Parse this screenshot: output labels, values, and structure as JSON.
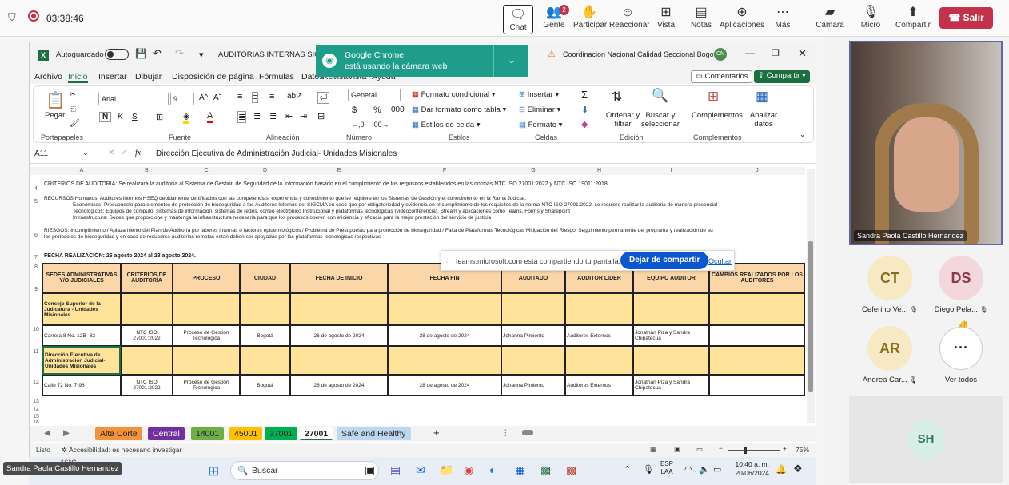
{
  "teams": {
    "time": "03:38:46",
    "chat": "Chat",
    "people": "Gente",
    "people_badge": "2",
    "raise": "Participar",
    "react": "Reaccionar",
    "view": "Vista",
    "notes": "Notas",
    "apps": "Aplicaciones",
    "more": "Más",
    "camera": "Cámara",
    "mic": "Micro",
    "share": "Compartir",
    "leave": "Salir"
  },
  "excel": {
    "autosave": "Autoguardado",
    "doc_title": "AUDITORIAS INTERNAS SIGCMA",
    "account": "Coordinacion Nacional Calidad Seccional Bogotá",
    "account_initials": "CN",
    "tabs": [
      "Archivo",
      "Inicio",
      "Insertar",
      "Dibujar",
      "Disposición de página",
      "Fórmulas",
      "Datos",
      "Revisar",
      "Vista",
      "Ayuda"
    ],
    "comments": "Comentarios",
    "share": "Compartir",
    "ribbon": {
      "paste": "Pegar",
      "font": "Arial",
      "size": "9",
      "numfmt": "General",
      "cond": "Formato condicional",
      "table": "Dar formato como tabla",
      "styles": "Estilos de celda",
      "insert": "Insertar",
      "delete": "Eliminar",
      "format": "Formato",
      "sort": "Ordenar y filtrar",
      "find": "Buscar y seleccionar",
      "addins": "Complementos",
      "analyze": "Analizar datos",
      "groups": [
        "Portapapeles",
        "Fuente",
        "Alineación",
        "Número",
        "Estilos",
        "Celdas",
        "Edición",
        "Complementos"
      ]
    },
    "namebox": "A11",
    "formula": "Dirección Ejecutiva de Administración Judicial- Unidades Misionales",
    "cols": [
      "A",
      "B",
      "C",
      "D",
      "E",
      "F",
      "G",
      "H",
      "I",
      "J"
    ],
    "criterios": "CRITERIOS DE AUDITORIA: Se realizará la auditoría al Sistema de Gestión de Seguridad de la Información basado en el cumplimiento de los requisitos establecidos en las normas NTC ISO 27001:2022 y NTC ISO 19011:2018",
    "rec_h": "RECURSOS:Humanos: Auditores internos HSEQ debidamente certificados con las competencias, experiencia y conocimiento que se requiere en los Sistemas de Gestión y el conocimiento en la Rama Judicial.",
    "rec_e": "Económicos: Presupuesto para elementos de protección de bioseguridad a los Auditores Internos del SIGCMA en caso que por obligatoriedad y evidencia en el cumplimiento de los requisitos de la norma NTC ISO 27001:2022, se requiere realizar la auditoria de manera presencial",
    "rec_t": "Tecnológicos: Equipos de computo, sistemas de información, sistemas de redes, correo electrónico Institucional y plataformas tecnologicas (videoconferencia), Stream y aplicaciones como Teams, Forms y Sharepoint",
    "rec_i": "Infraestructura: Sedes que proporcione y mantenga la infraestructura necesaria para que los procesos operen con eficiencia y eficacia para la mejor prestación del servicio de justicia",
    "riesgos1": "RIESGOS: Incumplimiento / Aplazamiento del Plan de Auditoría por labores internas o factores epidemiológicos / Problema de Presupuesto para protección de bioseguridad / Falta de Plataformas Tecnológicas Mitigación del Riesgo: Seguimiento permanente del programa y realización de su",
    "riesgos2": "los protocolos de bioseguridad y en caso de requerirse auditorias remotas estan deben ser apoyadas por las plataformas tecnologicas respectivas",
    "fecha": "FECHA REALIZACIÓN: 26 agosto 2024 al 28 agosto 2024.",
    "headers": [
      "SEDES ADMINISTRATIVAS Y/O JUDICIALES",
      "CRITERIOS DE AUDITORÍA",
      "PROCESO",
      "CIUDAD",
      "FECHA DE INICIO",
      "FECHA FIN",
      "AUDITADO",
      "AUDITOR LIDER",
      "EQUIPO AUDITOR",
      "CAMBIOS REALIZADOS POR LOS AUDITORES"
    ],
    "sede1": "Consejo Superior de la Judicatura - Unidades Misionales",
    "row10": [
      "Carrera 8 No. 12B- 82",
      "NTC ISO 27001:2022",
      "Proceso de Gestión Tecnologica",
      "Bogotá",
      "26 de agosto de 2024",
      "28 de agosto de 2024",
      "Johanna Pimiento",
      "Auditores Externos",
      "Jonathan Piza y Sandra Chipatecua",
      ""
    ],
    "sede2": "Dirección Ejecutiva de Administración Judicial- Unidades Misionales",
    "row12": [
      "Calle 72 No. 7-96",
      "NTC ISO 27001:2022",
      "Proceso de Gestión Tecnologica",
      "Bogotá",
      "26 de agosto de 2024",
      "28 de agosto de 2024",
      "Johanna Pimiento",
      "Auditores Externos",
      "Jonathan Piza y Sandra Chipatecua",
      ""
    ],
    "rownums": [
      "4",
      "5",
      "6",
      "7",
      "8",
      "9",
      "10",
      "11",
      "12",
      "13",
      "14",
      "15",
      "16"
    ],
    "sheets": [
      "Alta Corte",
      "Central",
      "14001",
      "45001",
      "37001",
      "27001",
      "Safe and Healthy"
    ],
    "sheet_colors": [
      "#f4943a",
      "#7030a0",
      "#70ad47",
      "#ffc000",
      "#00b050",
      "#ffffff",
      "#bdd7ee"
    ],
    "status_ready": "Listo",
    "accessibility": "Accesibilidad: es necesario investigar",
    "zoom": "75%"
  },
  "toast": {
    "title": "Google Chrome",
    "body": "está usando la cámara web"
  },
  "share_banner": {
    "text": "teams.microsoft.com está compartiendo tu pantalla.",
    "stop": "Dejar de compartir",
    "hide": "Ocultar"
  },
  "taskbar": {
    "search": "Buscar",
    "weather": "16°C",
    "lang1": "ESP",
    "lang2": "LAA",
    "time": "10:40 a. m.",
    "date": "20/06/2024"
  },
  "presenter": "Sandra Paola Castillo Hernandez",
  "self_name": "Sandra Paola Castillo Hernandez",
  "participants": [
    {
      "initials": "CT",
      "name": "Ceferino Ve...",
      "color": "#f7e9c4",
      "fg": "#8a6d1c"
    },
    {
      "initials": "DS",
      "name": "Diego Pela...",
      "color": "#f3d7dc",
      "fg": "#8c3a4a"
    },
    {
      "initials": "AR",
      "name": "Andrea Car...",
      "color": "#f7e9c4",
      "fg": "#8a6d1c"
    }
  ],
  "view_all": "Ver todos",
  "bottom_initials": "SH"
}
